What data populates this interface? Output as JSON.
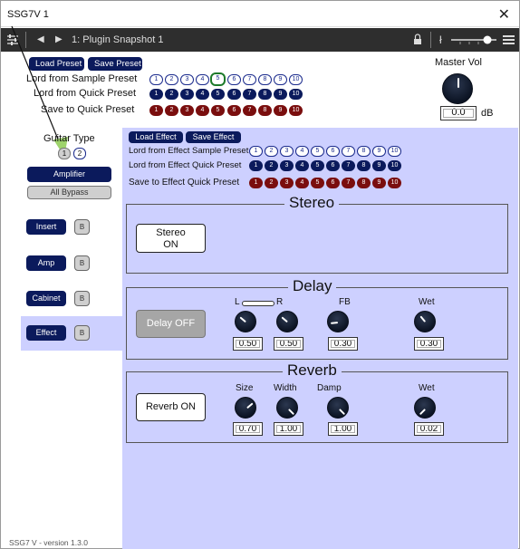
{
  "window": {
    "title": "SSG7V 1",
    "close_glyph": "✕"
  },
  "host": {
    "preset_name": "1: Plugin Snapshot 1"
  },
  "top": {
    "load_preset": "Load Preset",
    "save_preset": "Save Preset",
    "sample_label": "Lord from Sample Preset",
    "quick_label": "Lord from Quick Preset",
    "save_quick_label": "Save to Quick Preset",
    "preset_numbers": [
      "1",
      "2",
      "3",
      "4",
      "5",
      "6",
      "7",
      "8",
      "9",
      "10"
    ],
    "selected_sample": "5",
    "master_vol_label": "Master Vol",
    "master_vol_value": "0.0",
    "master_vol_unit": "dB"
  },
  "sidebar": {
    "guitar_type_label": "Guitar Type",
    "guitar_types": [
      "1",
      "2"
    ],
    "selected_guitar_type": "2",
    "amplifier": "Amplifier",
    "all_bypass": "All Bypass",
    "modules": [
      {
        "label": "Insert",
        "bypass": "B"
      },
      {
        "label": "Amp",
        "bypass": "B"
      },
      {
        "label": "Cabinet",
        "bypass": "B"
      },
      {
        "label": "Effect",
        "bypass": "B"
      }
    ],
    "selected_module": "Effect",
    "version": "SSG7 V - version 1.3.0"
  },
  "effect": {
    "load_effect": "Load Effect",
    "save_effect": "Save Effect",
    "sample_label": "Lord from Effect Sample Preset",
    "quick_label": "Lord from Effect Quick Preset",
    "save_quick_label": "Save to Effect Quick Preset"
  },
  "stereo": {
    "title": "Stereo",
    "button": "Stereo\nON"
  },
  "delay": {
    "title": "Delay",
    "button": "Delay OFF",
    "link_left": "L",
    "link_right": "R",
    "fb_label": "FB",
    "wet_label": "Wet",
    "values": {
      "l": "0.50",
      "r": "0.50",
      "fb": "0.30",
      "wet": "0.30"
    }
  },
  "reverb": {
    "title": "Reverb",
    "button": "Reverb ON",
    "labels": {
      "size": "Size",
      "width": "Width",
      "damp": "Damp",
      "wet": "Wet"
    },
    "values": {
      "size": "0.70",
      "width": "1.00",
      "damp": "1.00",
      "wet": "0.02"
    }
  },
  "colors": {
    "panel": "#cdd0ff",
    "dark_button": "#0b1a5c",
    "save_red": "#7a0e0e",
    "accent_green": "#9ed36b"
  }
}
